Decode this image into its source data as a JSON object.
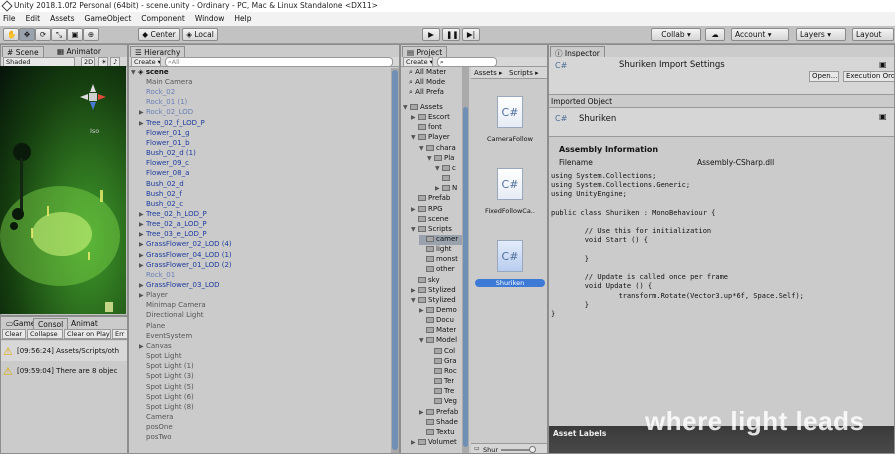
{
  "window": {
    "title": "Unity 2018.1.0f2 Personal (64bit) - scene.unity - Ordinary - PC, Mac & Linux Standalone <DX11>"
  },
  "menu": [
    "File",
    "Edit",
    "Assets",
    "GameObject",
    "Component",
    "Window",
    "Help"
  ],
  "toolbar": {
    "center": "Center",
    "local": "Local",
    "collab": "Collab ▾",
    "account": "Account",
    "layers": "Layers",
    "layout": "Layout"
  },
  "scene": {
    "tab_scene": "Scene",
    "tab_animator": "Animator",
    "shaded": "Shaded",
    "mode2d": "2D",
    "iso": "Iso"
  },
  "console": {
    "tabs": [
      "Game",
      "Consol",
      "Animat"
    ],
    "buttons": [
      "Clear",
      "Collapse",
      "Clear on Play",
      "Err"
    ],
    "messages": [
      "[09:56:24] Assets/Scripts/oth",
      "[09:59:04] There are 8 objec"
    ]
  },
  "hierarchy": {
    "tab": "Hierarchy",
    "create": "Create ▾",
    "search": "All",
    "root": "scene",
    "items": [
      {
        "label": "Main Camera",
        "style": "gray",
        "arrow": ""
      },
      {
        "label": "Rock_02",
        "style": "faded",
        "arrow": ""
      },
      {
        "label": "Rock_01 (1)",
        "style": "faded",
        "arrow": ""
      },
      {
        "label": "Rock_02_LOD",
        "style": "faded",
        "arrow": "▶"
      },
      {
        "label": "Tree_02_f_LOD_P",
        "style": "blue",
        "arrow": "▶"
      },
      {
        "label": "Flower_01_g",
        "style": "blue",
        "arrow": ""
      },
      {
        "label": "Flower_01_b",
        "style": "blue",
        "arrow": ""
      },
      {
        "label": "Bush_02_d (1)",
        "style": "blue",
        "arrow": ""
      },
      {
        "label": "Flower_09_c",
        "style": "blue",
        "arrow": ""
      },
      {
        "label": "Flower_08_a",
        "style": "blue",
        "arrow": ""
      },
      {
        "label": "Bush_02_d",
        "style": "blue",
        "arrow": ""
      },
      {
        "label": "Bush_02_f",
        "style": "blue",
        "arrow": ""
      },
      {
        "label": "Bush_02_c",
        "style": "blue",
        "arrow": ""
      },
      {
        "label": "Tree_02_h_LOD_P",
        "style": "blue",
        "arrow": "▶"
      },
      {
        "label": "Tree_02_a_LOD_P",
        "style": "blue",
        "arrow": "▶"
      },
      {
        "label": "Tree_03_e_LOD_P",
        "style": "blue",
        "arrow": "▶"
      },
      {
        "label": "GrassFlower_02_LOD (4)",
        "style": "blue",
        "arrow": "▶"
      },
      {
        "label": "GrassFlower_04_LOD (1)",
        "style": "blue",
        "arrow": "▶"
      },
      {
        "label": "GrassFlower_01_LOD (2)",
        "style": "blue",
        "arrow": "▶"
      },
      {
        "label": "Rock_01",
        "style": "faded",
        "arrow": ""
      },
      {
        "label": "GrassFlower_03_LOD",
        "style": "blue",
        "arrow": "▶"
      },
      {
        "label": "Player",
        "style": "gray",
        "arrow": "▶"
      },
      {
        "label": "Minimap Camera",
        "style": "gray",
        "arrow": ""
      },
      {
        "label": "Directional Light",
        "style": "gray",
        "arrow": ""
      },
      {
        "label": "Plane",
        "style": "gray",
        "arrow": ""
      },
      {
        "label": "EventSystem",
        "style": "gray",
        "arrow": ""
      },
      {
        "label": "Canvas",
        "style": "gray",
        "arrow": "▶"
      },
      {
        "label": "Spot Light",
        "style": "gray",
        "arrow": ""
      },
      {
        "label": "Spot Light (1)",
        "style": "gray",
        "arrow": ""
      },
      {
        "label": "Spot Light (3)",
        "style": "gray",
        "arrow": ""
      },
      {
        "label": "Spot Light (5)",
        "style": "gray",
        "arrow": ""
      },
      {
        "label": "Spot Light (6)",
        "style": "gray",
        "arrow": ""
      },
      {
        "label": "Spot Light (8)",
        "style": "gray",
        "arrow": ""
      },
      {
        "label": "Camera",
        "style": "gray",
        "arrow": ""
      },
      {
        "label": "posOne",
        "style": "gray",
        "arrow": ""
      },
      {
        "label": "posTwo",
        "style": "gray",
        "arrow": ""
      }
    ]
  },
  "project": {
    "tab": "Project",
    "create": "Create ▾",
    "favorites": [
      "All Mater",
      "All Mode",
      "All Prefa"
    ],
    "breadcrumb": [
      "Assets ▸",
      "Scripts ▸"
    ],
    "tree": [
      {
        "label": "Assets",
        "indent": 0,
        "arrow": "▼"
      },
      {
        "label": "Escort",
        "indent": 1,
        "arrow": "▶"
      },
      {
        "label": "font",
        "indent": 1,
        "arrow": ""
      },
      {
        "label": "Player",
        "indent": 1,
        "arrow": "▼"
      },
      {
        "label": "chara",
        "indent": 2,
        "arrow": "▼"
      },
      {
        "label": "Pla",
        "indent": 3,
        "arrow": "▼"
      },
      {
        "label": "c",
        "indent": 4,
        "arrow": "▼"
      },
      {
        "label": "",
        "indent": 4,
        "arrow": ""
      },
      {
        "label": "N",
        "indent": 4,
        "arrow": "▶"
      },
      {
        "label": "Prefab",
        "indent": 1,
        "arrow": ""
      },
      {
        "label": "RPG",
        "indent": 1,
        "arrow": "▶"
      },
      {
        "label": "scene",
        "indent": 1,
        "arrow": ""
      },
      {
        "label": "Scripts",
        "indent": 1,
        "arrow": "▼"
      },
      {
        "label": "camer",
        "indent": 2,
        "arrow": ""
      },
      {
        "label": "light",
        "indent": 2,
        "arrow": ""
      },
      {
        "label": "monst",
        "indent": 2,
        "arrow": ""
      },
      {
        "label": "other",
        "indent": 2,
        "arrow": ""
      },
      {
        "label": "sky",
        "indent": 1,
        "arrow": ""
      },
      {
        "label": "Stylized",
        "indent": 1,
        "arrow": "▶"
      },
      {
        "label": "Stylized",
        "indent": 1,
        "arrow": "▼"
      },
      {
        "label": "Demo",
        "indent": 2,
        "arrow": "▶"
      },
      {
        "label": "Docu",
        "indent": 2,
        "arrow": ""
      },
      {
        "label": "Mater",
        "indent": 2,
        "arrow": ""
      },
      {
        "label": "Model",
        "indent": 2,
        "arrow": "▼"
      },
      {
        "label": "Col",
        "indent": 3,
        "arrow": ""
      },
      {
        "label": "Gra",
        "indent": 3,
        "arrow": ""
      },
      {
        "label": "Roc",
        "indent": 3,
        "arrow": ""
      },
      {
        "label": "Ter",
        "indent": 3,
        "arrow": ""
      },
      {
        "label": "Tre",
        "indent": 3,
        "arrow": ""
      },
      {
        "label": "Veg",
        "indent": 3,
        "arrow": ""
      },
      {
        "label": "Prefab",
        "indent": 2,
        "arrow": "▶"
      },
      {
        "label": "Shade",
        "indent": 2,
        "arrow": ""
      },
      {
        "label": "Textu",
        "indent": 2,
        "arrow": ""
      },
      {
        "label": "Volumet",
        "indent": 1,
        "arrow": "▶"
      }
    ],
    "files": [
      "CameraFollow",
      "FixedFollowCa..",
      "Shuriken"
    ],
    "selected_file": "Shuriken",
    "search_bottom": "Shur"
  },
  "inspector": {
    "tab": "Inspector",
    "header": "Shuriken Import Settings",
    "open": "Open...",
    "exec_order": "Execution Order",
    "imported_object": "Imported Object",
    "object_name": "Shuriken",
    "assembly_title": "Assembly Information",
    "filename_label": "Filename",
    "filename_value": "Assembly-CSharp.dll",
    "code": "using System.Collections;\nusing System.Collections.Generic;\nusing UnityEngine;\n\npublic class Shuriken : MonoBehaviour {\n\n\t// Use this for initialization\n\tvoid Start () {\n\n\t}\n\n\t// Update is called once per frame\n\tvoid Update () {\n\t\ttransform.Rotate(Vector3.up*6f, Space.Self);\n\t}\n}",
    "asset_labels": "Asset Labels"
  },
  "watermark": "where light leads"
}
